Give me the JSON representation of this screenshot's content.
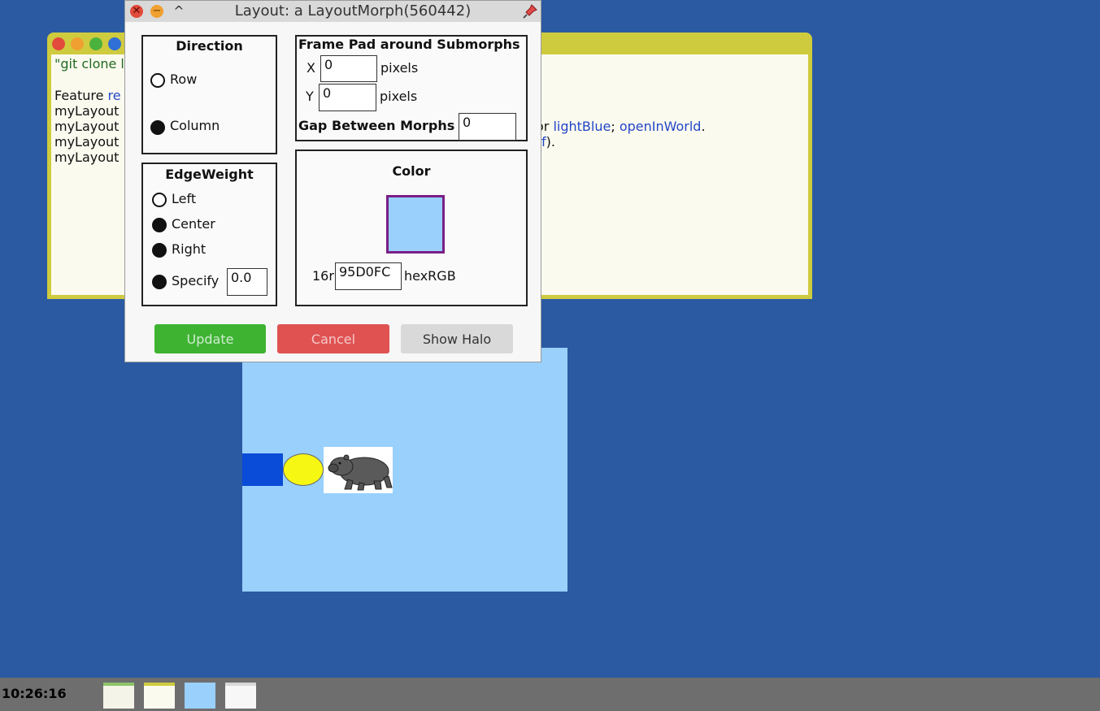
{
  "workspace": {
    "lines": {
      "l1": "\"git clone l",
      "l2_prefix": "Feature ",
      "l2_link": "re",
      "l3": "myLayout",
      "l4": "myLayout",
      "l5": "myLayout",
      "l6": "myLayout",
      "l4_tail_prefix": "or ",
      "l4_tail_link1": "lightBlue",
      "l4_tail_sep": "; ",
      "l4_tail_link2": "openInWorld",
      "l4_tail_end": ".",
      "l5_tail_link": "f",
      "l5_tail_end": ")."
    }
  },
  "dialog": {
    "title": "Layout: a LayoutMorph(560442)",
    "direction": {
      "heading": "Direction",
      "options": [
        "Row",
        "Column"
      ],
      "selected": "Column"
    },
    "frame_pad": {
      "heading": "Frame Pad around Submorphs",
      "x_label": "X",
      "x_value": "0",
      "y_label": "Y",
      "y_value": "0",
      "unit": "pixels",
      "gap_label": "Gap Between Morphs",
      "gap_value": "0"
    },
    "edge_weight": {
      "heading": "EdgeWeight",
      "options": [
        "Left",
        "Center",
        "Right",
        "Specify"
      ],
      "specify_value": "0.0"
    },
    "color": {
      "heading": "Color",
      "swatch": "#99d0fc",
      "swatch_border": "#7a1f86",
      "radix_label": "16r",
      "hex_value": "95D0FC",
      "hex_suffix": "hexRGB"
    },
    "buttons": {
      "update": "Update",
      "cancel": "Cancel",
      "show_halo": "Show Halo"
    }
  },
  "colors": {
    "desktop": "#2b5aa2",
    "workspace_frame": "#cfcb3e",
    "morph_bg": "#99d0fc",
    "update_btn": "#3eb332",
    "cancel_btn": "#e05252",
    "halo_btn": "#d9d9d9"
  },
  "taskbar": {
    "clock": "10:26:16"
  }
}
